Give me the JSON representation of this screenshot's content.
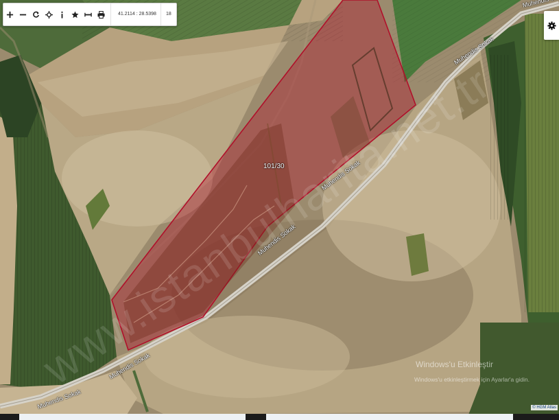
{
  "toolbar": {
    "buttons": [
      {
        "name": "zoom-in-button",
        "icon": "plus-icon"
      },
      {
        "name": "zoom-out-button",
        "icon": "minus-icon"
      },
      {
        "name": "refresh-button",
        "icon": "refresh-icon"
      },
      {
        "name": "locate-button",
        "icon": "crosshair-icon"
      },
      {
        "name": "info-button",
        "icon": "info-icon"
      },
      {
        "name": "favorite-button",
        "icon": "star-icon"
      },
      {
        "name": "measure-button",
        "icon": "ruler-icon"
      },
      {
        "name": "print-button",
        "icon": "printer-icon"
      }
    ],
    "coordinates": "41.2114 : 28.5398",
    "zoom_level": "18"
  },
  "settings": {
    "icon": "gear-icon"
  },
  "map": {
    "parcel_label": "101/30",
    "parcel_color": "#b0102a",
    "road_labels": {
      "top_right": "Muhendis Sokak",
      "upper": "Muhendis Sokak",
      "center": "Muhendis Sokak",
      "middle": "Muhendis Sokak",
      "bottom_left": "Muhendis Sokak",
      "bottom": "Muhendis Sokak"
    },
    "watermark": "www.istanbulharita.net.tr",
    "attribution": "© HGM Atlas"
  },
  "windows_activation": {
    "title": "Windows'u Etkinleştir",
    "subtitle": "Windows'u etkinleştirmek için Ayarlar'a gidin."
  }
}
